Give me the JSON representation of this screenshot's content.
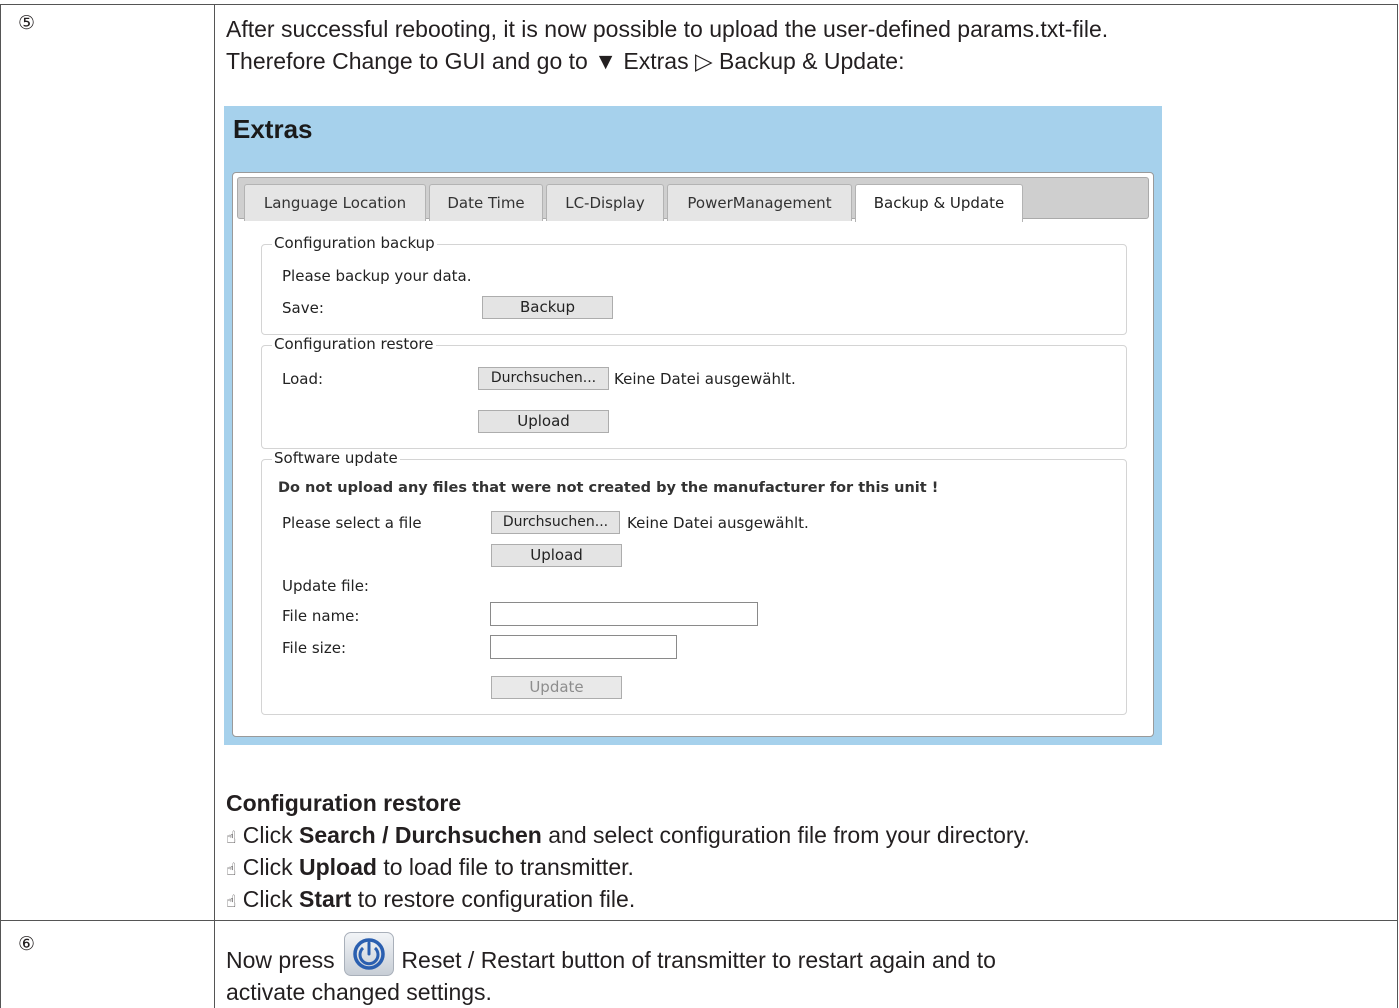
{
  "steps": [
    {
      "number": "⑤",
      "intro_line1": "After successful rebooting, it is now possible to upload the user-defined params.txt-file.",
      "intro_line2_prefix": "Therefore Change to GUI and go to ",
      "intro_line2_down_symbol": "▼",
      "intro_line2_menu": " Extras ",
      "intro_line2_right_symbol": "▷",
      "intro_line2_item": " Backup & Update:",
      "gui": {
        "title": "Extras",
        "tabs": [
          "Language Location",
          "Date Time",
          "LC-Display",
          "PowerManagement",
          "Backup & Update"
        ],
        "active_tab": "Backup & Update",
        "backup": {
          "legend": "Configuration backup",
          "text": "Please backup your data.",
          "save_label": "Save:",
          "backup_button": "Backup"
        },
        "restore": {
          "legend": "Configuration restore",
          "load_label": "Load:",
          "browse_button": "Durchsuchen...",
          "no_file": "Keine Datei ausgewählt.",
          "upload_button": "Upload"
        },
        "update": {
          "legend": "Software update",
          "warning": "Do not upload any files that were not created by the manufacturer for this unit !",
          "select_label": "Please select a file",
          "browse_button": "Durchsuchen...",
          "no_file": "Keine Datei ausgewählt.",
          "upload_button": "Upload",
          "update_file_label": "Update file:",
          "file_name_label": "File name:",
          "file_name_value": "",
          "file_size_label": "File size:",
          "file_size_value": "",
          "update_button": "Update"
        }
      },
      "section_heading": "Configuration restore",
      "hand_symbol": "☝",
      "instructions": [
        {
          "pre": " Click ",
          "bold": "Search / Durchsuchen",
          "post": " and select configuration file from your directory."
        },
        {
          "pre": " Click ",
          "bold": "Upload",
          "post": " to load file to transmitter."
        },
        {
          "pre": " Click ",
          "bold": "Start",
          "post": " to restore configuration file."
        }
      ]
    },
    {
      "number": "⑥",
      "text_before_icon": "Now press ",
      "icon": "power-icon",
      "text_after_icon": " Reset / Restart button of transmitter to restart again and to",
      "text_line2": "activate changed settings."
    }
  ],
  "colors": {
    "gui_background": "#a6d1ec",
    "border": "#555555",
    "power_icon": "#2a5fb0"
  }
}
